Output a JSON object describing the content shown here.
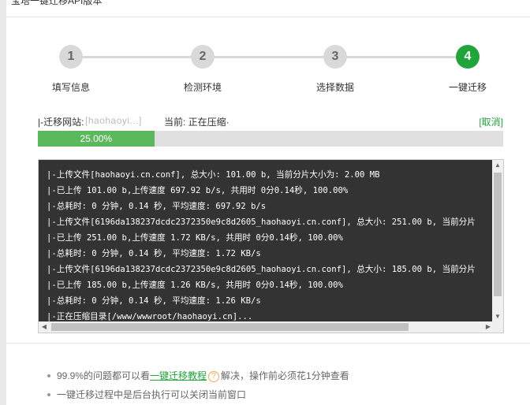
{
  "header": {
    "title": "宝塔一键迁移API版本"
  },
  "steps": [
    {
      "number": "1",
      "label": "填写信息",
      "active": false
    },
    {
      "number": "2",
      "label": "检测环境",
      "active": false
    },
    {
      "number": "3",
      "label": "选择数据",
      "active": false
    },
    {
      "number": "4",
      "label": "一键迁移",
      "active": true
    }
  ],
  "status": {
    "site_label": "|-迁移网站:",
    "site_name": "[haohaoyi...]",
    "current_label": "当前: 正在压缩·",
    "cancel": "[取消]"
  },
  "progress": {
    "percent": 25,
    "text": "25.00%"
  },
  "log": {
    "lines": [
      "|-上传文件[haohaoyi.cn.conf], 总大小: 101.00 b, 当前分片大小为: 2.00 MB",
      "|-已上传 101.00 b,上传速度 697.92 b/s, 共用时 0分0.14秒,  100.00%",
      "|-总耗时: 0 分钟, 0.14 秒, 平均速度: 697.92 b/s",
      "|-上传文件[6196da138237dcdc2372350e9c8d2605_haohaoyi.cn.conf], 总大小: 251.00 b, 当前分片",
      "|-已上传 251.00 b,上传速度 1.72 KB/s, 共用时 0分0.14秒,  100.00%",
      "|-总耗时: 0 分钟, 0.14 秒, 平均速度: 1.72 KB/s",
      "|-上传文件[6196da138237dcdc2372350e9c8d2605_haohaoyi.cn.conf], 总大小: 185.00 b, 当前分片",
      "|-已上传 185.00 b,上传速度 1.26 KB/s, 共用时 0分0.14秒,  100.00%",
      "|-总耗时: 0 分钟, 0.14 秒, 平均速度: 1.26 KB/s",
      "|-正在压缩目录[/www/wwwroot/haohaoyi.cn]..."
    ]
  },
  "tips": {
    "tip1_before": "99.9%的问题都可以看",
    "tip1_link": "一键迁移教程",
    "tip1_help": "?",
    "tip1_after": "解决，操作前必须花1分钟查看",
    "tip2": "一键迁移过程中是后台执行可以关闭当前窗口"
  }
}
